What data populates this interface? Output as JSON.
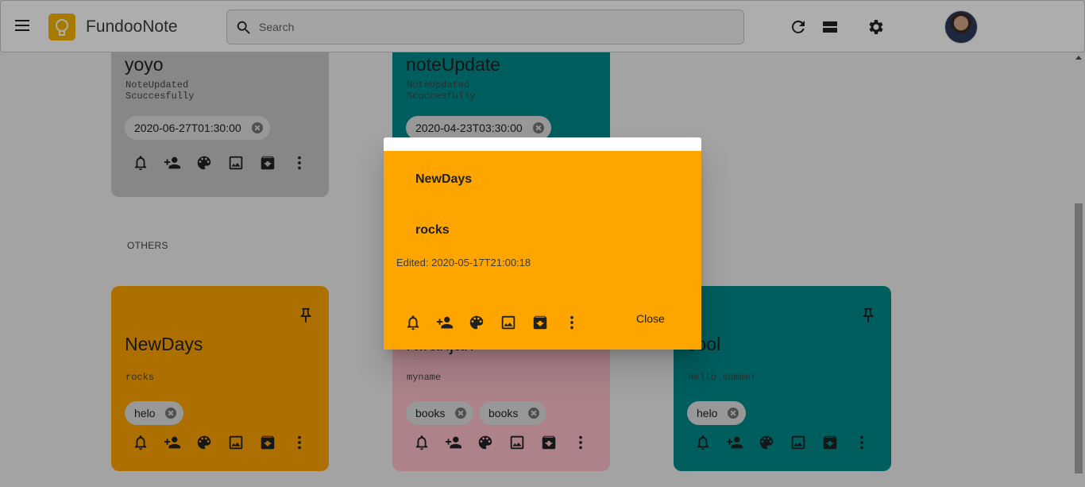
{
  "header": {
    "app_title": "FundooNote",
    "search_placeholder": "Search"
  },
  "sections": {
    "others_label": "OTHERS"
  },
  "pinned_notes": [
    {
      "title": "yoyo",
      "body": "NoteUpdated\nScuccesfully",
      "labels": [
        "2020-06-27T01:30:00"
      ],
      "color": "#c8c8c8"
    },
    {
      "title": "noteUpdate",
      "body": "NoteUpdated\nScuccesfully",
      "labels": [
        "2020-04-23T03:30:00"
      ],
      "color": "#008b8b"
    }
  ],
  "other_notes": [
    {
      "title": "NewDays",
      "body": "rocks",
      "labels": [
        "helo"
      ],
      "color": "#ffa500"
    },
    {
      "title": "Niranjan",
      "body": "myname",
      "labels": [
        "books",
        "books"
      ],
      "color": "#ffc0cb"
    },
    {
      "title": "cool",
      "body": "Hello summer",
      "labels": [
        "helo"
      ],
      "color": "#008b8b"
    }
  ],
  "dialog": {
    "title": "NewDays",
    "body": "rocks",
    "edited": "Edited: 2020-05-17T21:00:18",
    "close_label": "Close",
    "color": "#ffa500"
  },
  "icons": [
    "menu-icon",
    "bulb-icon",
    "search-icon",
    "refresh-icon",
    "list-view-icon",
    "gear-icon",
    "bell-icon",
    "add-person-icon",
    "palette-icon",
    "image-icon",
    "archive-icon",
    "more-vert-icon",
    "pin-icon"
  ]
}
